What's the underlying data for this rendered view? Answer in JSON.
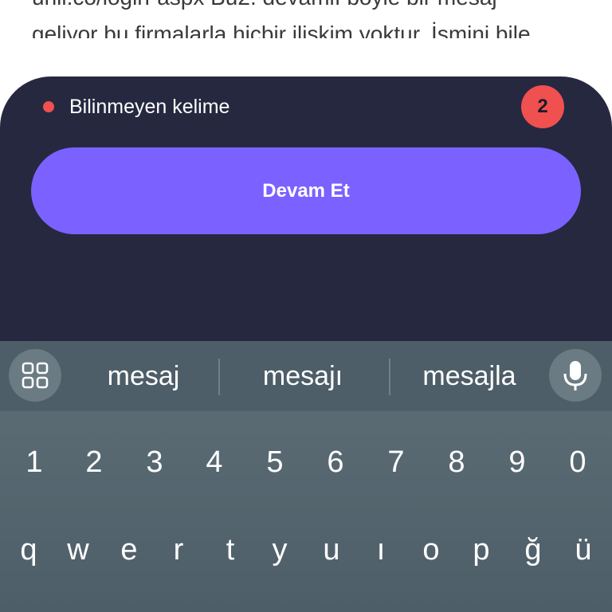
{
  "background_page": {
    "line1": "unli.co/login-aspx Bu2. devamlı böyle bir mesaj",
    "line2": "geliyor bu firmalarla hiçbir ilişkim yoktur. İsmini bile"
  },
  "sheet": {
    "status_label": "Bilinmeyen kelime",
    "status_count": "2",
    "continue_label": "Devam Et",
    "colors": {
      "background": "#262840",
      "accent": "#7b61ff",
      "alert": "#f0504f"
    }
  },
  "keyboard": {
    "apps_icon": "grid-icon",
    "mic_icon": "microphone-icon",
    "suggestions": [
      "mesaj",
      "mesajı",
      "mesajla"
    ],
    "number_row": [
      "1",
      "2",
      "3",
      "4",
      "5",
      "6",
      "7",
      "8",
      "9",
      "0"
    ],
    "letter_row": [
      "q",
      "w",
      "e",
      "r",
      "t",
      "y",
      "u",
      "ı",
      "o",
      "p",
      "ğ",
      "ü"
    ]
  }
}
